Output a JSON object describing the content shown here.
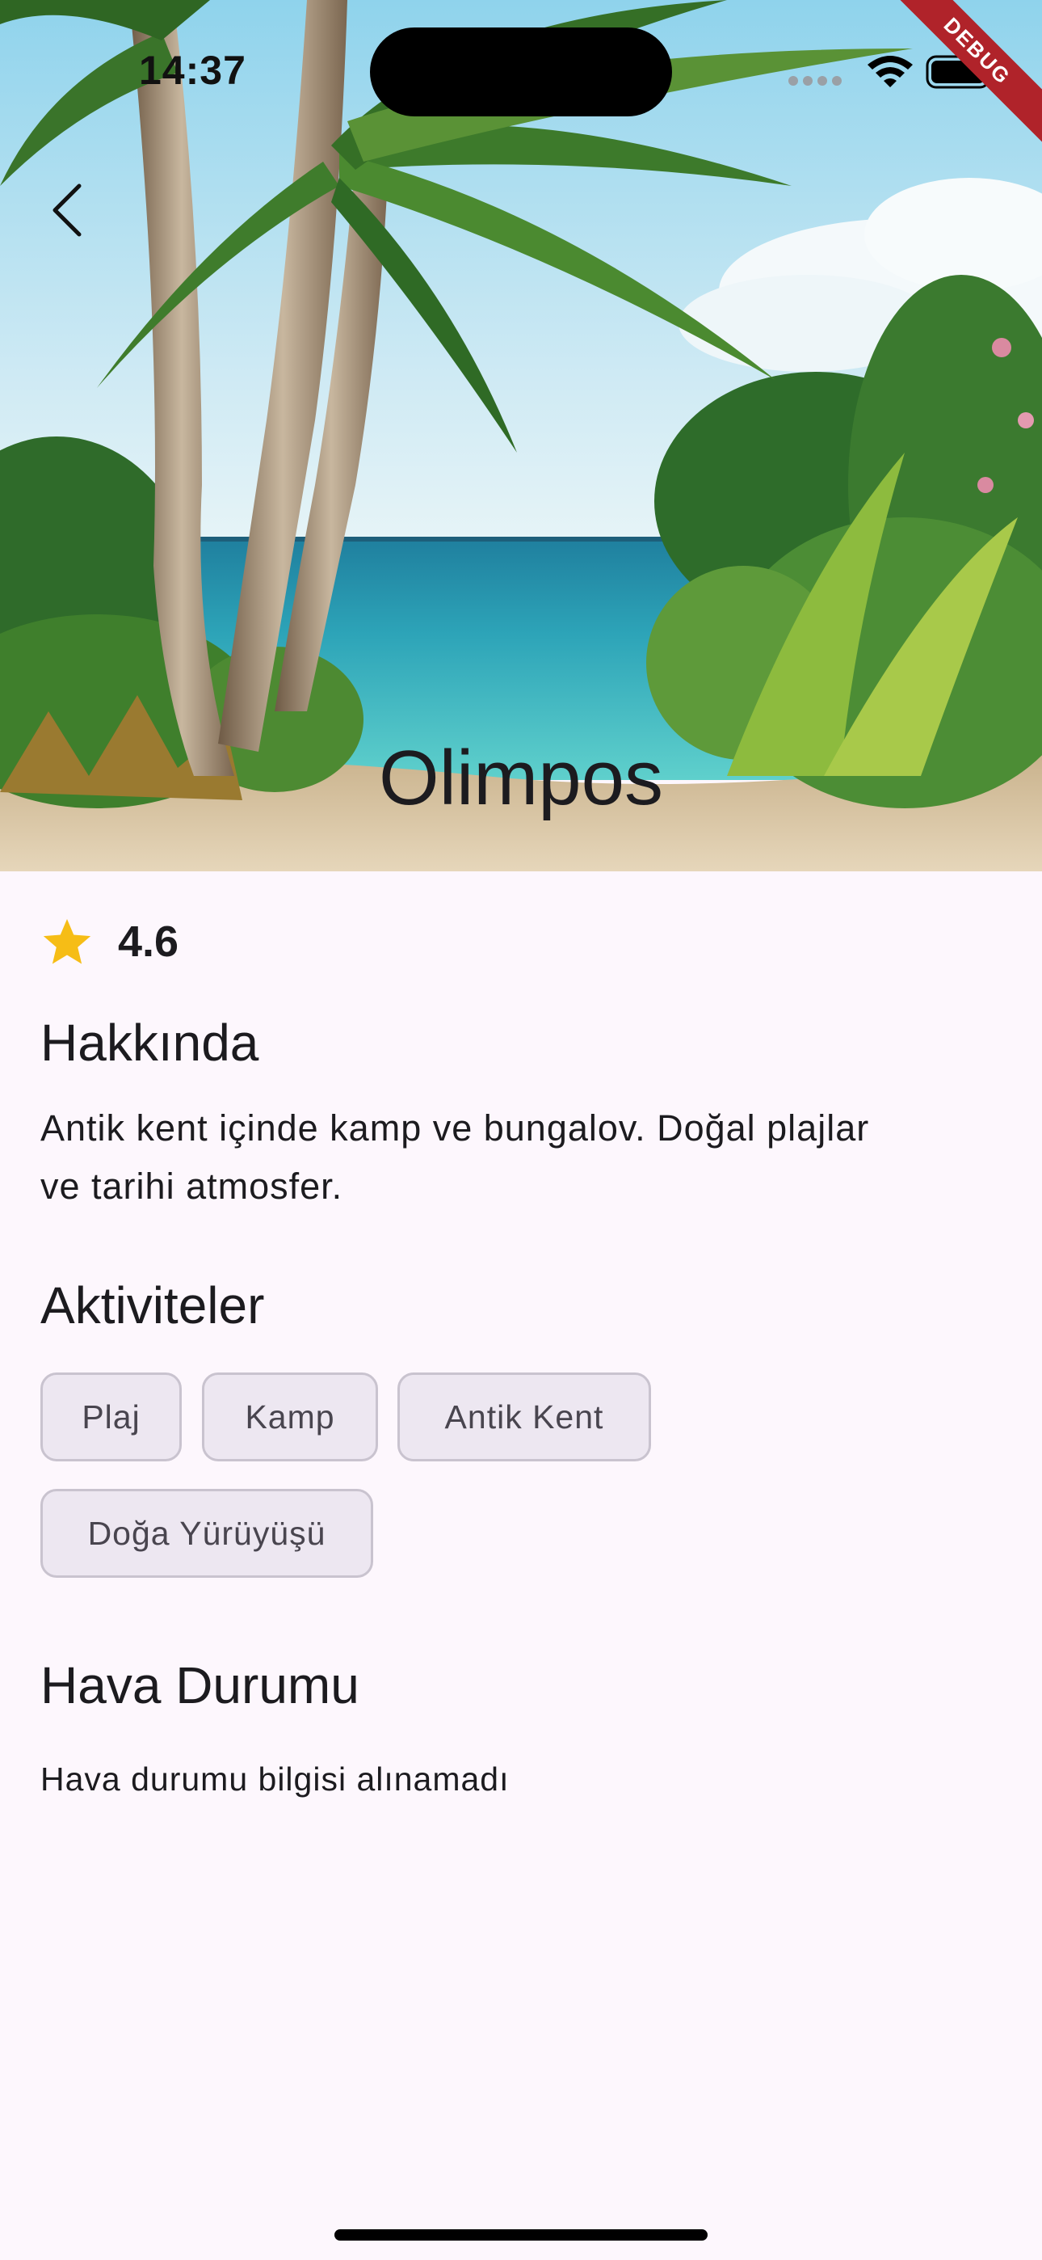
{
  "status_bar": {
    "time": "14:37",
    "icons": [
      "cellular-icon",
      "wifi-icon",
      "battery-icon"
    ]
  },
  "debug_banner": "DEBUG",
  "hero": {
    "title": "Olimpos",
    "image": "beach-with-palm-trees-photo"
  },
  "rating": {
    "icon": "star-icon",
    "value": "4.6",
    "star_color": "#f6bd16"
  },
  "about": {
    "title": "Hakkında",
    "line1": "Antik kent içinde kamp ve bungalov. Doğal plajlar",
    "line2": "ve tarihi atmosfer."
  },
  "activities": {
    "title": "Aktiviteler",
    "chips": [
      "Plaj",
      "Kamp",
      "Antik Kent",
      "Doğa Yürüyüşü"
    ]
  },
  "weather": {
    "title": "Hava Durumu",
    "message": "Hava durumu bilgisi alınamadı"
  },
  "colors": {
    "background": "#fdf7fd",
    "chip_background": "#ede7f1",
    "chip_border": "#c9c3cf",
    "debug_ribbon": "#b0232a"
  }
}
